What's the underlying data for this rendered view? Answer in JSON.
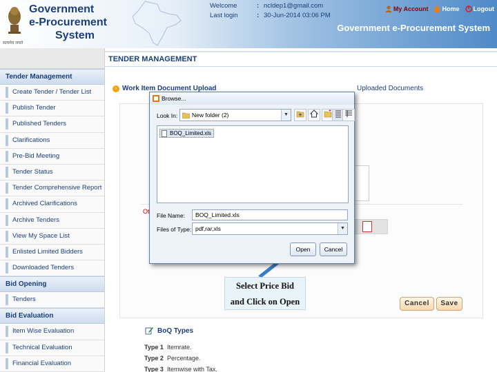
{
  "header": {
    "brand_line1": "Government",
    "brand_line2": "e-Procurement",
    "brand_line3": "System",
    "emblem_caption": "सत्यमेव जयते",
    "welcome_label": "Welcome",
    "welcome_value": "ncldep1@gmail.com",
    "last_login_label": "Last login",
    "last_login_value": "30-Jun-2014 03:06 PM",
    "separator": ":",
    "my_account": "My Account",
    "home": "Home",
    "logout": "Logout",
    "system_title": "Government e-Procurement System"
  },
  "sidebar": {
    "sections": [
      {
        "title": "Tender Management",
        "items": [
          "Create Tender / Tender List",
          "Publish Tender",
          "Published Tenders",
          "Clarifications",
          "Pre-Bid Meeting",
          "Tender Status",
          "Tender Comprehensive Report",
          "Archived Clarifications",
          "Archive Tenders",
          "View My Space List",
          "Enlisted Limited Bidders",
          "Downloaded Tenders"
        ]
      },
      {
        "title": "Bid Opening",
        "items": [
          "Tenders"
        ]
      },
      {
        "title": "Bid Evaluation",
        "items": [
          "Item Wise Evaluation",
          "Technical Evaluation",
          "Financial Evaluation"
        ]
      }
    ]
  },
  "main": {
    "heading": "TENDER MANAGEMENT",
    "breadcrumb": "Work Item Document Upload",
    "breadcrumb_rest": "Uploaded Documents",
    "red_text": "Ot",
    "cancel_label": "Cancel",
    "save_label": "Save",
    "boq_title": "BoQ Types",
    "boq_types": [
      {
        "label": "Type 1",
        "desc": "Itemrate."
      },
      {
        "label": "Type 2",
        "desc": "Percentage."
      },
      {
        "label": "Type 3",
        "desc": "Itemwise with Tax."
      }
    ]
  },
  "callout": {
    "line1": "Select Price Bid",
    "line2": "and Click on Open"
  },
  "dialog": {
    "title": "Browse...",
    "look_in_label": "Look In:",
    "look_in_value": "New folder (2)",
    "files": [
      "BOQ_Limited.xls"
    ],
    "file_name_label": "File Name:",
    "file_name_value": "BOQ_Limited.xls",
    "file_type_label": "Files of Type:",
    "file_type_value": "pdf,rar,xls",
    "open_label": "Open",
    "cancel_label": "Cancel"
  },
  "colors": {
    "brand_blue": "#1a3f7a",
    "header_gradient_end": "#4f8ac8",
    "button_orange": "#f7d9ad",
    "callout_bg": "#e9f3fa"
  }
}
